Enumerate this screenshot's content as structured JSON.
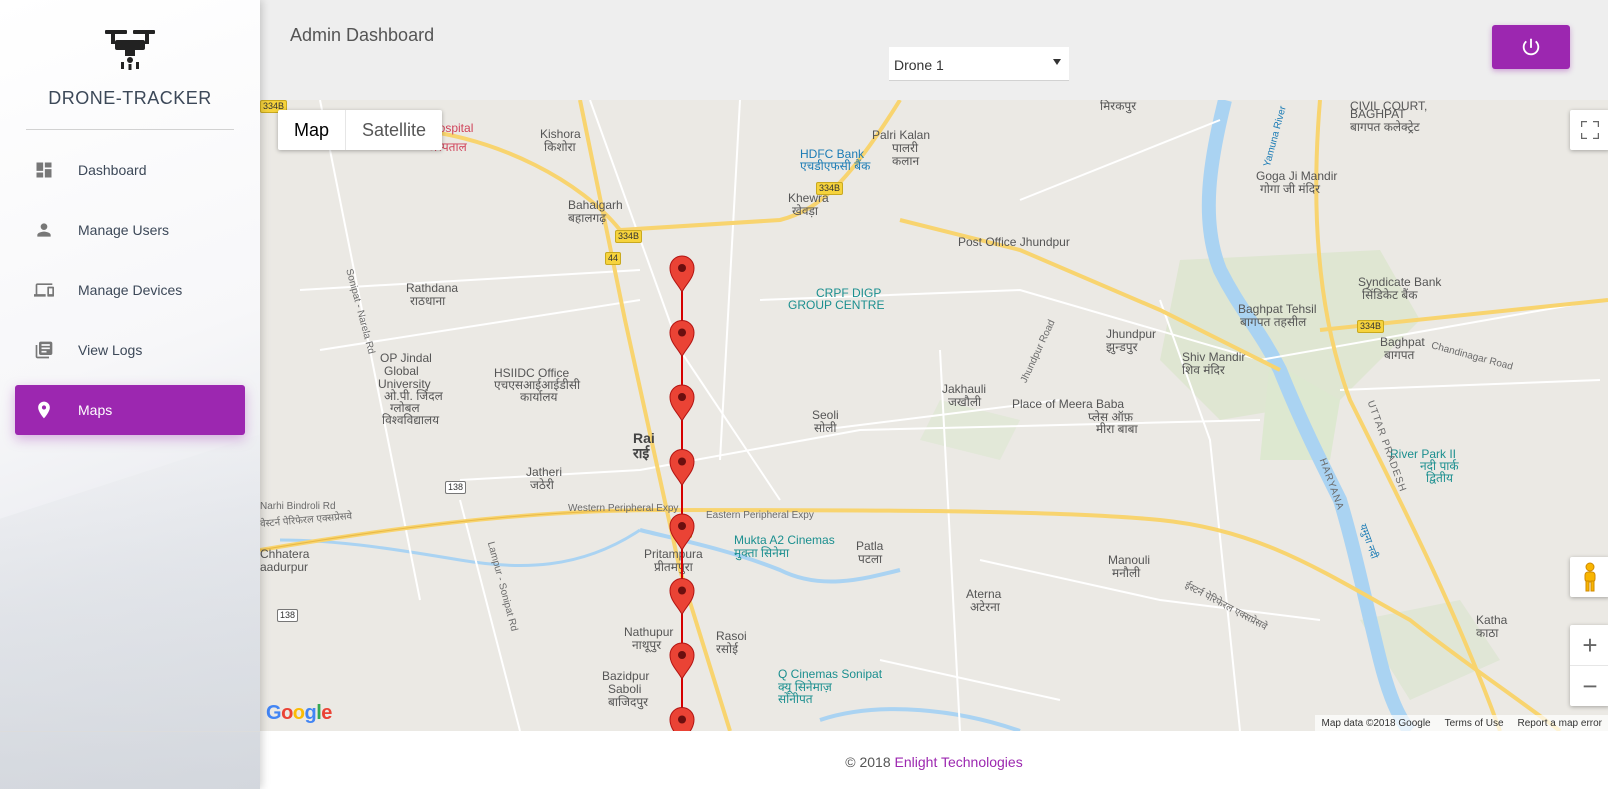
{
  "app": {
    "name": "DRONE-TRACKER"
  },
  "sidebar": {
    "items": [
      {
        "label": "Dashboard",
        "icon": "dashboard-icon"
      },
      {
        "label": "Manage Users",
        "icon": "person-icon"
      },
      {
        "label": "Manage Devices",
        "icon": "devices-icon"
      },
      {
        "label": "View Logs",
        "icon": "library-books-icon"
      },
      {
        "label": "Maps",
        "icon": "location-pin-icon",
        "active": true
      }
    ]
  },
  "header": {
    "title": "Admin Dashboard",
    "device_select": {
      "value": "Drone 1"
    },
    "logout_icon": "power-icon"
  },
  "map": {
    "type_toggle": {
      "map": "Map",
      "satellite": "Satellite",
      "selected": "Map"
    },
    "controls": {
      "fullscreen": "fullscreen-icon",
      "pegman": "street-view-icon",
      "zoom_in": "+",
      "zoom_out": "−"
    },
    "markers_count": 8,
    "place_labels": [
      "Kishora",
      "किशोरा",
      "Bahalgarh",
      "बहालगढ़",
      "Palri Kalan",
      "पालरी",
      "कलान",
      "HDFC Bank",
      "एचडीएफसी बैंक",
      "Khewra",
      "खेवड़ा",
      "Post Office Jhundpur",
      "CRPF DIGP",
      "GROUP CENTRE",
      "Rathdana",
      "राठधाना",
      "OP Jindal",
      "Global",
      "University",
      "ओ.पी. जिंदल",
      "ग्लोबल",
      "विश्वविद्यालय",
      "HSIIDC Office",
      "एचएसआईआईडीसी",
      "कार्यालय",
      "Rai",
      "राई",
      "Seoli",
      "सोली",
      "Jakhauli",
      "जखौली",
      "Jhundpur",
      "झुन्डपुर",
      "Place of Meera Baba",
      "प्लेस ऑफ़",
      "मीरा बाबा",
      "Shiv Mandir",
      "शिव मंदिर",
      "Jatheri",
      "जठेरी",
      "Western Peripheral Expy",
      "Eastern Peripheral Expy",
      "Mukta A2 Cinemas",
      "मुक्ता सिनेमा",
      "Patla",
      "पटला",
      "Manouli",
      "मनौली",
      "Pritampura",
      "प्रीतमपुरा",
      "Aterna",
      "अटेरना",
      "Nathupur",
      "नाथूपुर",
      "Rasoi",
      "रसोई",
      "Q Cinemas Sonipat",
      "क्यू सिनेमाज़",
      "सोनीपत",
      "Bazidpur",
      "Saboli",
      "बाजिदपुर",
      "Goga Ji Mandir",
      "गोगा जी मंदिर",
      "Syndicate Bank",
      "सिंडिकेट बैंक",
      "Baghpat Tehsil",
      "बागपत तहसील",
      "Baghpat",
      "बागपत",
      "River Park II",
      "नदी पार्क",
      "द्वितीय",
      "Katha",
      "काठा",
      "CIVIL COURT,",
      "BAGHPAT",
      "बागपत कलेक्ट्रेट",
      "मिरकपुर",
      "Yamuna River",
      "HARYANA",
      "UTTAR PRADESH",
      "यमुना नदी",
      "Chandinagar Road",
      "Jhundpur Road",
      "Sonipat - Narela Rd",
      "Lampur - Sonipat Rd",
      "ईस्टर्न पेरिफेरल एक्सप्रेसवे",
      "वेस्टर्न पेरिफेरल एक्सप्रेसवे",
      "Chhatera",
      "aadurpur",
      "Hospital",
      "अस्पताल",
      "Narhi Bindroli Rd",
      "Sonipat - Narela Rd"
    ],
    "road_shields": [
      "334B",
      "334B",
      "334B",
      "44",
      "44",
      "138",
      "138",
      "334B"
    ],
    "google_logo": "Google",
    "attribution": {
      "map_data": "Map data ©2018 Google",
      "terms": "Terms of Use",
      "report": "Report a map error"
    }
  },
  "footer": {
    "copyright": "© 2018",
    "company": "Enlight Technologies"
  },
  "colors": {
    "accent": "#9c27b0",
    "marker": "#ea4335",
    "route": "#d50000"
  }
}
